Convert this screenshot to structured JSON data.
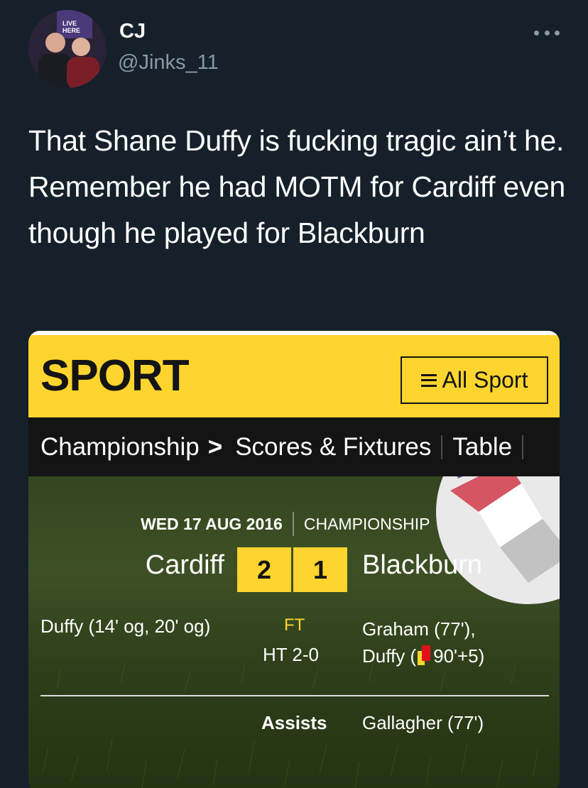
{
  "tweet": {
    "display_name": "CJ",
    "handle": "@Jinks_11",
    "text": "That Shane Duffy is fucking tragic ain’t he. Remember he had MOTM for Cardiff even though he played for Blackburn"
  },
  "avatar": {
    "banner_text": "LIVE HERE"
  },
  "media": {
    "header": {
      "logo": "SPORT",
      "all_sport_label": "All Sport"
    },
    "nav": {
      "competition": "Championship",
      "arrow": ">",
      "fixtures": "Scores & Fixtures",
      "table": "Table"
    },
    "match": {
      "date": "WED 17 AUG 2016",
      "competition": "CHAMPIONSHIP",
      "home_team": "Cardiff",
      "away_team": "Blackburn",
      "home_score": "2",
      "away_score": "1",
      "status": "FT",
      "half_time": "HT 2-0",
      "home_scorers": "Duffy (14' og, 20' og)",
      "away_scorers_line1": "Graham (77'),",
      "away_scorers_line2_prefix": "Duffy (",
      "away_scorers_line2_suffix": "90'+5)",
      "assists_label": "Assists",
      "assists_value": "Gallagher (77')"
    }
  },
  "colors": {
    "background": "#15202b",
    "bbc_yellow": "#fed42e",
    "muted_text": "#8b98a5",
    "red_card": "#e3101b"
  }
}
